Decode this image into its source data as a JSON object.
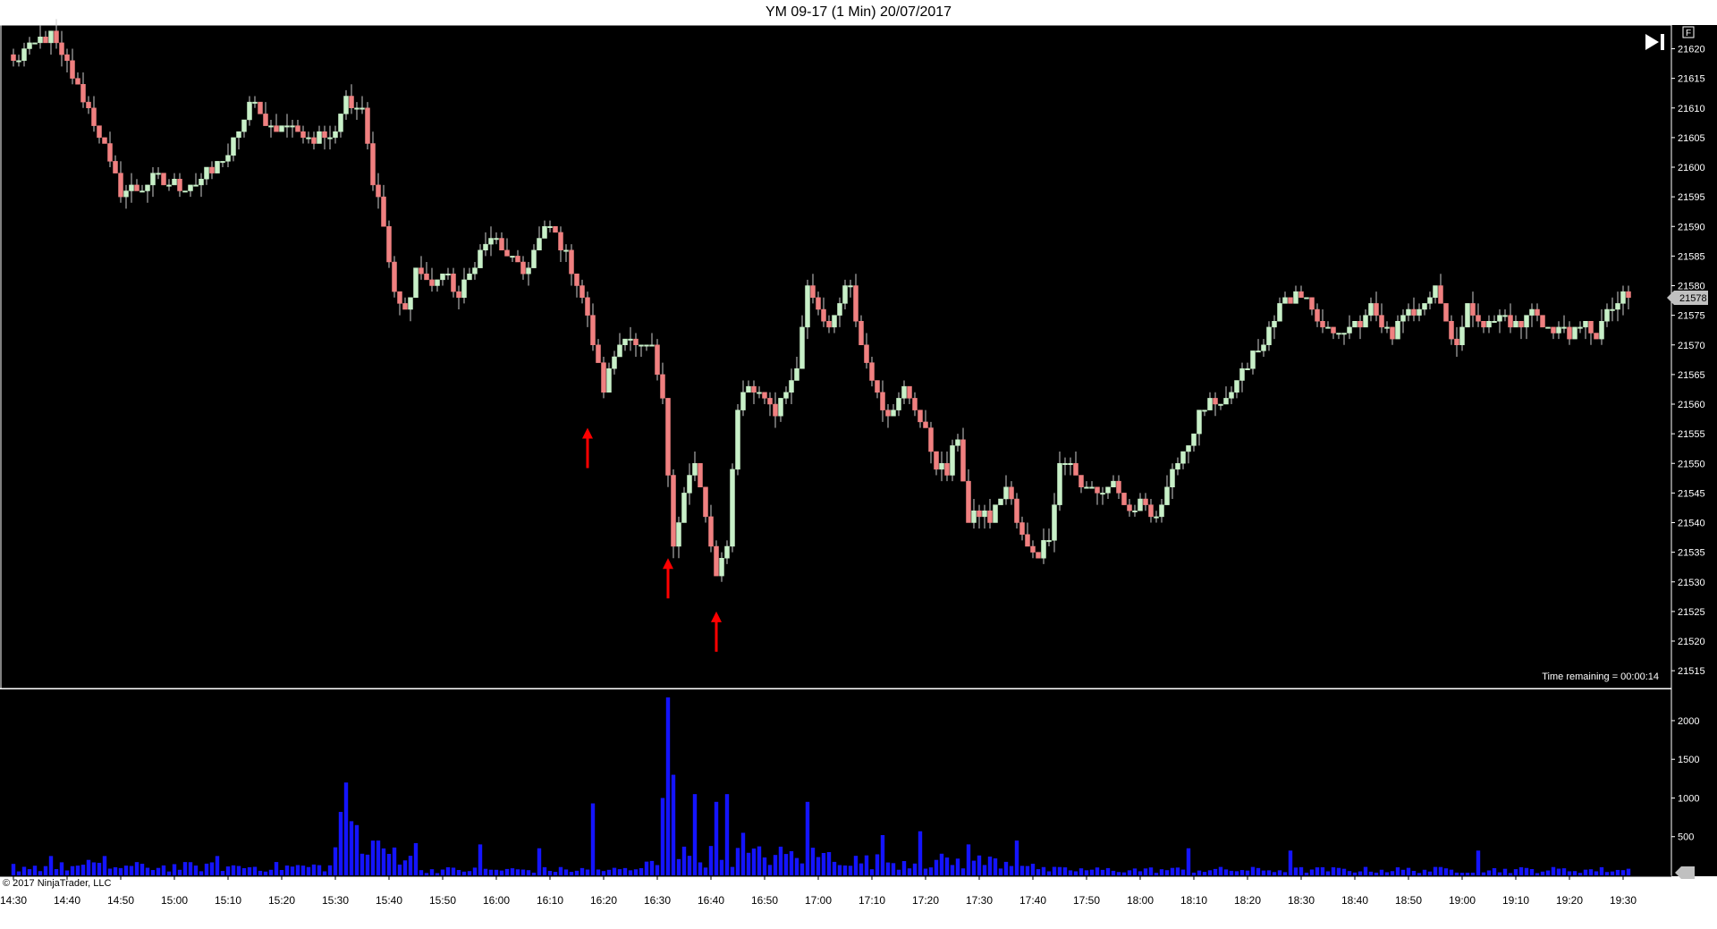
{
  "window": {
    "title": "YM 09-17 (1 Min)  20/07/2017"
  },
  "chart": {
    "copyright": "© 2017 NinjaTrader, LLC",
    "time_remaining": "Time remaining = 00:00:14",
    "last_price_tag": "21578",
    "f_button_label": "F",
    "colors": {
      "background": "#000000",
      "up_candle": "#c8f0c8",
      "down_candle": "#f08080",
      "volume": "#1414ff",
      "arrow": "#ff0000",
      "frame": "#ffffff"
    }
  },
  "chart_data": [
    {
      "type": "candlestick",
      "title": "YM 09-17 (1 Min)  20/07/2017",
      "interval": "1 Min",
      "ylim": [
        21512,
        21624
      ],
      "y_ticks": [
        21515,
        21520,
        21525,
        21530,
        21535,
        21540,
        21545,
        21550,
        21555,
        21560,
        21565,
        21570,
        21575,
        21580,
        21585,
        21590,
        21595,
        21600,
        21605,
        21610,
        21615,
        21620
      ],
      "x_ticks": [
        "14:30",
        "14:40",
        "14:50",
        "15:00",
        "15:10",
        "15:20",
        "15:30",
        "15:40",
        "15:50",
        "16:00",
        "16:10",
        "16:20",
        "16:30",
        "16:40",
        "16:50",
        "17:00",
        "17:10",
        "17:20",
        "17:30",
        "17:40",
        "17:50",
        "18:00",
        "18:10",
        "18:20",
        "18:30",
        "18:40",
        "18:50",
        "19:00",
        "19:10",
        "19:20",
        "19:30"
      ],
      "start_time": "14:30",
      "last_price": 21578,
      "close_path": [
        [
          "14:30",
          21618
        ],
        [
          "14:34",
          21621
        ],
        [
          "14:37",
          21622
        ],
        [
          "14:40",
          21617
        ],
        [
          "14:43",
          21612
        ],
        [
          "14:47",
          21603
        ],
        [
          "14:50",
          21596
        ],
        [
          "14:53",
          21596
        ],
        [
          "14:56",
          21598
        ],
        [
          "15:00",
          21597
        ],
        [
          "15:04",
          21597
        ],
        [
          "15:08",
          21600
        ],
        [
          "15:12",
          21605
        ],
        [
          "15:14",
          21611
        ],
        [
          "15:18",
          21607
        ],
        [
          "15:22",
          21607
        ],
        [
          "15:26",
          21604
        ],
        [
          "15:30",
          21607
        ],
        [
          "15:32",
          21612
        ],
        [
          "15:35",
          21610
        ],
        [
          "15:37",
          21598
        ],
        [
          "15:39",
          21590
        ],
        [
          "15:41",
          21578
        ],
        [
          "15:43",
          21576
        ],
        [
          "15:45",
          21583
        ],
        [
          "15:48",
          21580
        ],
        [
          "15:50",
          21582
        ],
        [
          "15:53",
          21578
        ],
        [
          "15:56",
          21584
        ],
        [
          "15:59",
          21588
        ],
        [
          "16:02",
          21585
        ],
        [
          "16:05",
          21582
        ],
        [
          "16:08",
          21588
        ],
        [
          "16:10",
          21590
        ],
        [
          "16:13",
          21585
        ],
        [
          "16:16",
          21578
        ],
        [
          "16:18",
          21570
        ],
        [
          "16:20",
          21563
        ],
        [
          "16:22",
          21568
        ],
        [
          "16:24",
          21572
        ],
        [
          "16:26",
          21570
        ],
        [
          "16:29",
          21569
        ],
        [
          "16:31",
          21560
        ],
        [
          "16:33",
          21537
        ],
        [
          "16:35",
          21545
        ],
        [
          "16:37",
          21550
        ],
        [
          "16:39",
          21541
        ],
        [
          "16:41",
          21530
        ],
        [
          "16:43",
          21537
        ],
        [
          "16:45",
          21560
        ],
        [
          "16:47",
          21563
        ],
        [
          "16:50",
          21561
        ],
        [
          "16:52",
          21559
        ],
        [
          "16:54",
          21563
        ],
        [
          "16:56",
          21565
        ],
        [
          "16:58",
          21580
        ],
        [
          "17:00",
          21575
        ],
        [
          "17:02",
          21573
        ],
        [
          "17:04",
          21578
        ],
        [
          "17:06",
          21580
        ],
        [
          "17:08",
          21570
        ],
        [
          "17:10",
          21565
        ],
        [
          "17:12",
          21560
        ],
        [
          "17:14",
          21558
        ],
        [
          "17:16",
          21563
        ],
        [
          "17:18",
          21560
        ],
        [
          "17:20",
          21555
        ],
        [
          "17:22",
          21550
        ],
        [
          "17:24",
          21548
        ],
        [
          "17:26",
          21555
        ],
        [
          "17:28",
          21540
        ],
        [
          "17:30",
          21542
        ],
        [
          "17:32",
          21540
        ],
        [
          "17:35",
          21546
        ],
        [
          "17:37",
          21540
        ],
        [
          "17:39",
          21536
        ],
        [
          "17:41",
          21535
        ],
        [
          "17:43",
          21538
        ],
        [
          "17:45",
          21550
        ],
        [
          "17:47",
          21550
        ],
        [
          "17:49",
          21546
        ],
        [
          "17:51",
          21546
        ],
        [
          "17:53",
          21545
        ],
        [
          "17:55",
          21547
        ],
        [
          "17:57",
          21542
        ],
        [
          "17:59",
          21542
        ],
        [
          "18:01",
          21544
        ],
        [
          "18:03",
          21541
        ],
        [
          "18:05",
          21545
        ],
        [
          "18:07",
          21551
        ],
        [
          "18:09",
          21553
        ],
        [
          "18:11",
          21558
        ],
        [
          "18:13",
          21560
        ],
        [
          "18:15",
          21559
        ],
        [
          "18:17",
          21562
        ],
        [
          "18:19",
          21565
        ],
        [
          "18:21",
          21568
        ],
        [
          "18:23",
          21570
        ],
        [
          "18:25",
          21575
        ],
        [
          "18:27",
          21577
        ],
        [
          "18:29",
          21579
        ],
        [
          "18:31",
          21577
        ],
        [
          "18:33",
          21573
        ],
        [
          "18:35",
          21572
        ],
        [
          "18:37",
          21573
        ],
        [
          "18:39",
          21572
        ],
        [
          "18:41",
          21574
        ],
        [
          "18:43",
          21576
        ],
        [
          "18:45",
          21573
        ],
        [
          "18:47",
          21572
        ],
        [
          "18:49",
          21574
        ],
        [
          "18:51",
          21576
        ],
        [
          "18:53",
          21578
        ],
        [
          "18:55",
          21580
        ],
        [
          "18:57",
          21574
        ],
        [
          "18:59",
          21570
        ],
        [
          "19:01",
          21576
        ],
        [
          "19:03",
          21575
        ],
        [
          "19:05",
          21573
        ],
        [
          "19:07",
          21575
        ],
        [
          "19:09",
          21574
        ],
        [
          "19:11",
          21573
        ],
        [
          "19:13",
          21576
        ],
        [
          "19:15",
          21574
        ],
        [
          "19:17",
          21572
        ],
        [
          "19:19",
          21573
        ],
        [
          "19:21",
          21572
        ],
        [
          "19:23",
          21573
        ],
        [
          "19:25",
          21572
        ],
        [
          "19:27",
          21575
        ],
        [
          "19:29",
          21577
        ],
        [
          "19:31",
          21578
        ]
      ],
      "annotations": [
        {
          "type": "arrow-up",
          "time": "16:17",
          "price": 21556
        },
        {
          "type": "arrow-up",
          "time": "16:32",
          "price": 21534
        },
        {
          "type": "arrow-up",
          "time": "16:41",
          "price": 21525
        }
      ]
    },
    {
      "type": "bar",
      "title": "Volume",
      "ylim": [
        0,
        2300
      ],
      "y_ticks": [
        500,
        1000,
        1500,
        2000
      ],
      "base_level": 70,
      "peaks": [
        [
          "14:37",
          250
        ],
        [
          "14:44",
          200
        ],
        [
          "14:47",
          250
        ],
        [
          "15:08",
          250
        ],
        [
          "15:31",
          820
        ],
        [
          "15:32",
          1200
        ],
        [
          "15:33",
          700
        ],
        [
          "15:34",
          650
        ],
        [
          "15:38",
          450
        ],
        [
          "15:57",
          400
        ],
        [
          "16:08",
          350
        ],
        [
          "16:18",
          930
        ],
        [
          "16:31",
          1000
        ],
        [
          "16:32",
          2300
        ],
        [
          "16:33",
          1300
        ],
        [
          "16:37",
          1050
        ],
        [
          "16:41",
          950
        ],
        [
          "16:43",
          1050
        ],
        [
          "16:46",
          550
        ],
        [
          "16:58",
          950
        ],
        [
          "17:12",
          520
        ],
        [
          "17:19",
          570
        ],
        [
          "17:28",
          400
        ],
        [
          "17:37",
          450
        ],
        [
          "18:09",
          350
        ],
        [
          "18:28",
          320
        ],
        [
          "19:03",
          320
        ]
      ]
    }
  ]
}
